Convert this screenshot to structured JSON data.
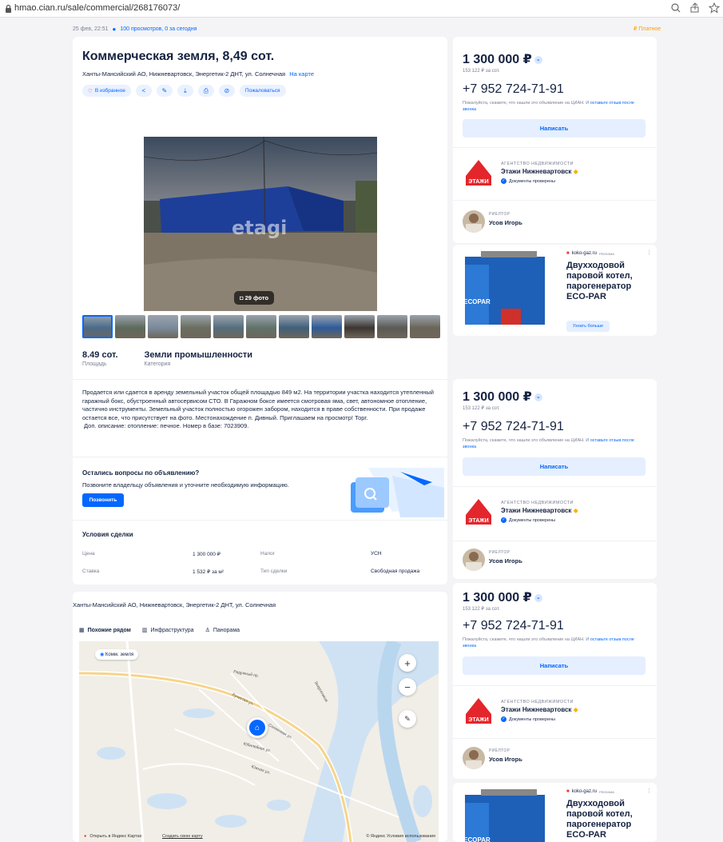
{
  "browser": {
    "url": "hmao.cian.ru/sale/commercial/268176073/"
  },
  "meta": {
    "date": "25 фев, 22:51",
    "views": "100 просмотров, 0 за сегодня",
    "paid": "₽ Платное"
  },
  "listing": {
    "title": "Коммерческая земля, 8,49 сот.",
    "address": "Ханты-Мансийский АО, Нижневартовск, Энергетик-2 ДНТ, ул. Солнечная",
    "on_map": "На карте",
    "favorite": "В избранное",
    "complain": "Пожаловаться",
    "photo_watermark": "etagi",
    "photo_count": "29 фото",
    "thumbs": [
      "#4a6b8a",
      "#5d6a5c",
      "#7a8a9a",
      "#6b6e5f",
      "#556e7d",
      "#60726a",
      "#3f5f7a",
      "#2e5a9a",
      "#3c3530",
      "#5b5a55",
      "#6b6458"
    ],
    "facts": [
      {
        "value": "8.49 сот.",
        "label": "Площадь"
      },
      {
        "value": "Земли промышленности",
        "label": "Категория"
      }
    ],
    "description": "Продается или сдается в аренду земельный участок общей площадью 849 м2. На территории участка находится утепленный гаражный бокс, обустроенный автосервисом СТО. В Гаражном боксе имеется смотровая яма, свет, автономное отопление, частично инструменты. Земельный участок полностью огорожен забором, находится в праве собственности. При продаже остается все, что присутствует на фото. Местонахождение п. Дивный. Приглашаем на просмотр! Торг.",
    "description2": "Доп. описание: отопление: печное. Номер в базе: 7023909.",
    "questions_title": "Остались вопросы по объявлению?",
    "questions_text": "Позвоните владельцу объявления и уточните необходимую информацию.",
    "call": "Позвонить",
    "conditions_title": "Условия сделки",
    "conditions": {
      "price_label": "Цена",
      "price_value": "1 300 000 ₽",
      "tax_label": "Налог",
      "tax_value": "УСН",
      "rate_label": "Ставка",
      "rate_value": "1 532 ₽ за м²",
      "deal_label": "Тип сделки",
      "deal_value": "Свободная продажа"
    }
  },
  "map": {
    "address": "Ханты-Мансийский АО, Нижневартовск, Энергетик-2 ДНТ, ул. Солнечная",
    "tabs": [
      "Похожие рядом",
      "Инфраструктура",
      "Панорама"
    ],
    "pill": "Комм. земля",
    "open": "Открыть в Яндекс Картах",
    "create": "Создать свою карту",
    "terms": "© Яндекс Условия использования",
    "streets": [
      "Радужный пр.",
      "Лучистая ул.",
      "Солнечная ул.",
      "Юбилейная ул.",
      "Южная ул.",
      "Энергетиков"
    ]
  },
  "contact": {
    "price": "1 300 000 ₽",
    "price_per": "153 122 ₽ за сот.",
    "phone": "+7 952 724-71-91",
    "hint": "Пожалуйста, скажите, что нашли это объявление на ЦИАН. И ",
    "hint_link": "оставьте отзыв после звонка",
    "write": "Написать",
    "agency_type": "АГЕНТСТВО НЕДВИЖИМОСТИ",
    "agency_name": "Этажи Нижневартовск",
    "agency_docs": "Документы проверены",
    "agency_logo_text": "ЭТАЖИ",
    "realtor_role": "РИЕЛТОР",
    "realtor_name": "Усов Игорь"
  },
  "ad": {
    "source": "koko-gaz.ru",
    "tag": "РЕКЛАМА",
    "title": "Двухходовой паровой котел, парогенератор ECO-PAR",
    "button": "Узнать больше",
    "brand": "ECOPAR"
  }
}
